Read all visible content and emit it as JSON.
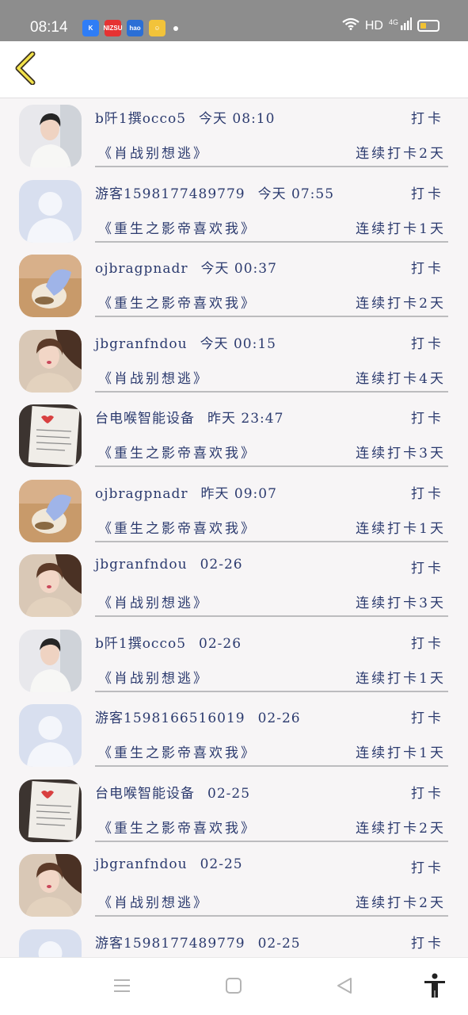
{
  "status_bar": {
    "time": "08:14",
    "apps": [
      {
        "label": "K",
        "color": "#2f7df6",
        "icon": "app-k-icon"
      },
      {
        "label": "NIZSU",
        "color": "#e63232",
        "icon": "app-red-icon"
      },
      {
        "label": "hao",
        "color": "#2b6fd6",
        "icon": "app-baidu-icon"
      },
      {
        "label": "☺",
        "color": "#f2c33a",
        "icon": "app-face-icon"
      }
    ],
    "network": "HD",
    "network_gen": "4G",
    "battery_level": 0.35
  },
  "header": {
    "back_icon": "chevron-left-icon"
  },
  "feed": [
    {
      "user": "b阡1撰occo5",
      "time": "今天 08:10",
      "book": "《肖战别想逃》",
      "streak": "连续打卡2天",
      "action": "打卡",
      "avatar": "boy"
    },
    {
      "user": "游客1598177489779",
      "time": "今天 07:55",
      "book": "《重生之影帝喜欢我》",
      "streak": "连续打卡1天",
      "action": "打卡",
      "avatar": "default"
    },
    {
      "user": "ojbragpnadr",
      "time": "今天 00:37",
      "book": "《重生之影帝喜欢我》",
      "streak": "连续打卡2天",
      "action": "打卡",
      "avatar": "bird"
    },
    {
      "user": "jbgranfndou",
      "time": "今天 00:15",
      "book": "《肖战别想逃》",
      "streak": "连续打卡4天",
      "action": "打卡",
      "avatar": "girl"
    },
    {
      "user": "台电喉智能设备",
      "time": "昨天 23:47",
      "book": "《重生之影帝喜欢我》",
      "streak": "连续打卡3天",
      "action": "打卡",
      "avatar": "notebook"
    },
    {
      "user": "ojbragpnadr",
      "time": "昨天 09:07",
      "book": "《重生之影帝喜欢我》",
      "streak": "连续打卡1天",
      "action": "打卡",
      "avatar": "bird"
    },
    {
      "user": "jbgranfndou",
      "time": "02-26",
      "book": "《肖战别想逃》",
      "streak": "连续打卡3天",
      "action": "打卡",
      "avatar": "girl"
    },
    {
      "user": "b阡1撰occo5",
      "time": "02-26",
      "book": "《肖战别想逃》",
      "streak": "连续打卡1天",
      "action": "打卡",
      "avatar": "boy"
    },
    {
      "user": "游客1598166516019",
      "time": "02-26",
      "book": "《重生之影帝喜欢我》",
      "streak": "连续打卡1天",
      "action": "打卡",
      "avatar": "default"
    },
    {
      "user": "台电喉智能设备",
      "time": "02-25",
      "book": "《重生之影帝喜欢我》",
      "streak": "连续打卡2天",
      "action": "打卡",
      "avatar": "notebook"
    },
    {
      "user": "jbgranfndou",
      "time": "02-25",
      "book": "《肖战别想逃》",
      "streak": "连续打卡2天",
      "action": "打卡",
      "avatar": "girl"
    },
    {
      "user": "游客1598177489779",
      "time": "02-25",
      "book": "",
      "streak": "",
      "action": "打卡",
      "avatar": "default"
    }
  ],
  "nav": {
    "menu_icon": "menu-icon",
    "home_icon": "home-square-icon",
    "back_icon": "back-triangle-icon",
    "accessibility_icon": "accessibility-icon"
  }
}
